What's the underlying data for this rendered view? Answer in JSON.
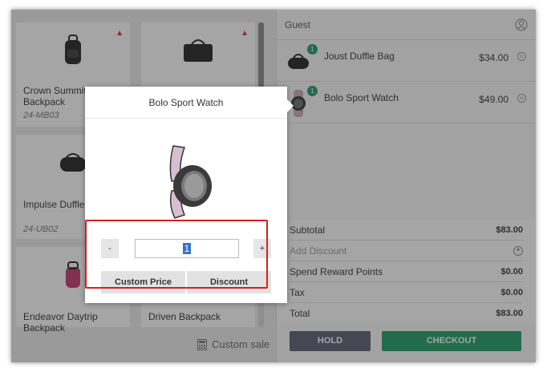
{
  "products": [
    {
      "name": "Crown Summit Backpack",
      "sku": "24-MB03",
      "warning": true
    },
    {
      "name": "",
      "sku": "",
      "warning": true
    },
    {
      "name": "Impulse Duffle",
      "sku": "24-UB02",
      "warning": false
    },
    {
      "name": "Endeavor Daytrip Backpack",
      "sku": "",
      "warning": false
    },
    {
      "name": "Driven Backpack",
      "sku": "",
      "warning": false
    }
  ],
  "custom_sale_label": "Custom sale",
  "cart": {
    "customer": "Guest",
    "items": [
      {
        "name": "Joust Duffle Bag",
        "price": "$34.00",
        "qty": "1"
      },
      {
        "name": "Bolo Sport Watch",
        "price": "$49.00",
        "qty": "1"
      }
    ],
    "totals": {
      "subtotal_label": "Subtotal",
      "subtotal": "$83.00",
      "add_discount_label": "Add Discount",
      "reward_label": "Spend Reward Points",
      "reward": "$0.00",
      "tax_label": "Tax",
      "tax": "$0.00",
      "total_label": "Total",
      "total": "$83.00"
    },
    "hold_label": "HOLD",
    "checkout_label": "CHECKOUT"
  },
  "popup": {
    "title": "Bolo Sport Watch",
    "minus_label": "-",
    "plus_label": "+",
    "qty": "1",
    "custom_price_label": "Custom Price",
    "discount_label": "Discount"
  },
  "colors": {
    "accent": "#1e9e64",
    "hold": "#5a6070",
    "highlight": "#d9201c"
  }
}
